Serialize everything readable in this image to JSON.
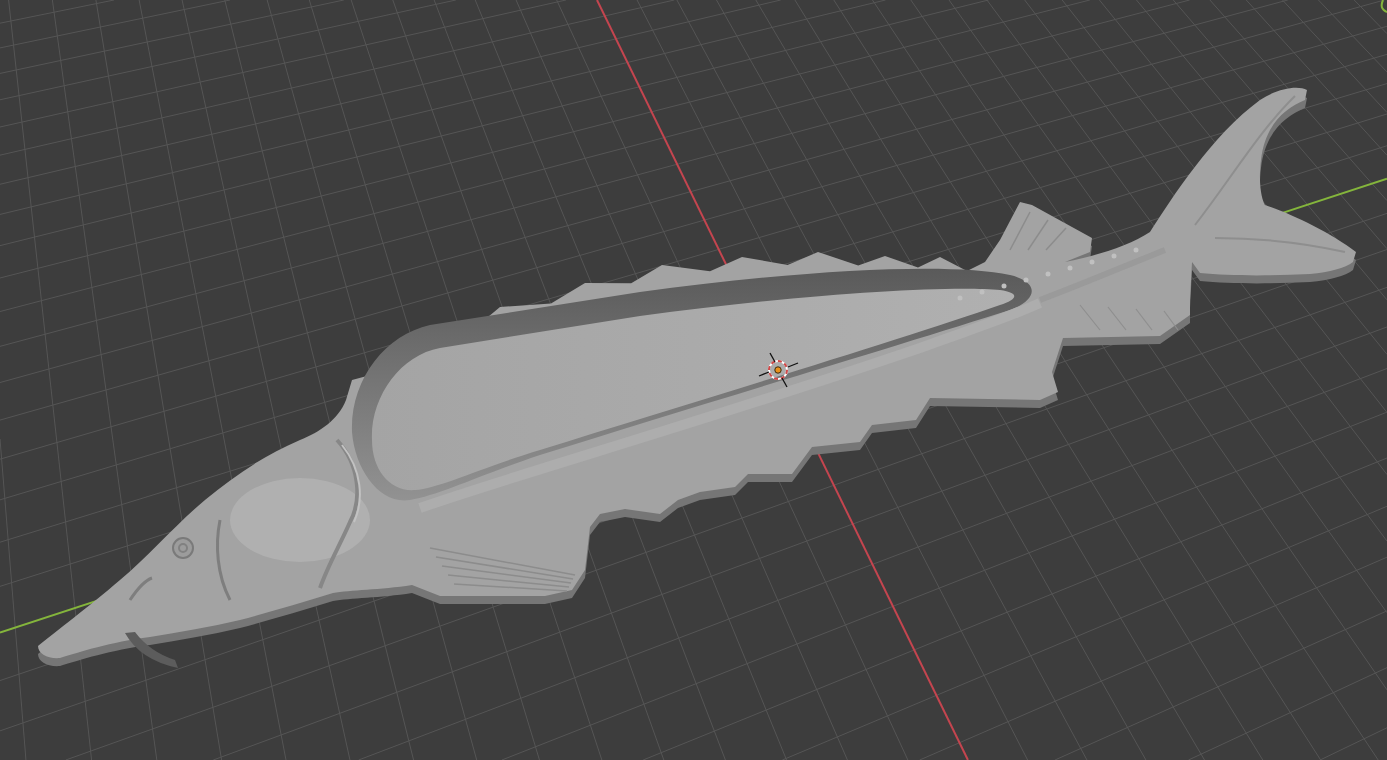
{
  "viewport": {
    "axes": [
      {
        "kind": "x",
        "color": "#c4454f"
      },
      {
        "kind": "y",
        "color": "#84b53c"
      }
    ]
  }
}
